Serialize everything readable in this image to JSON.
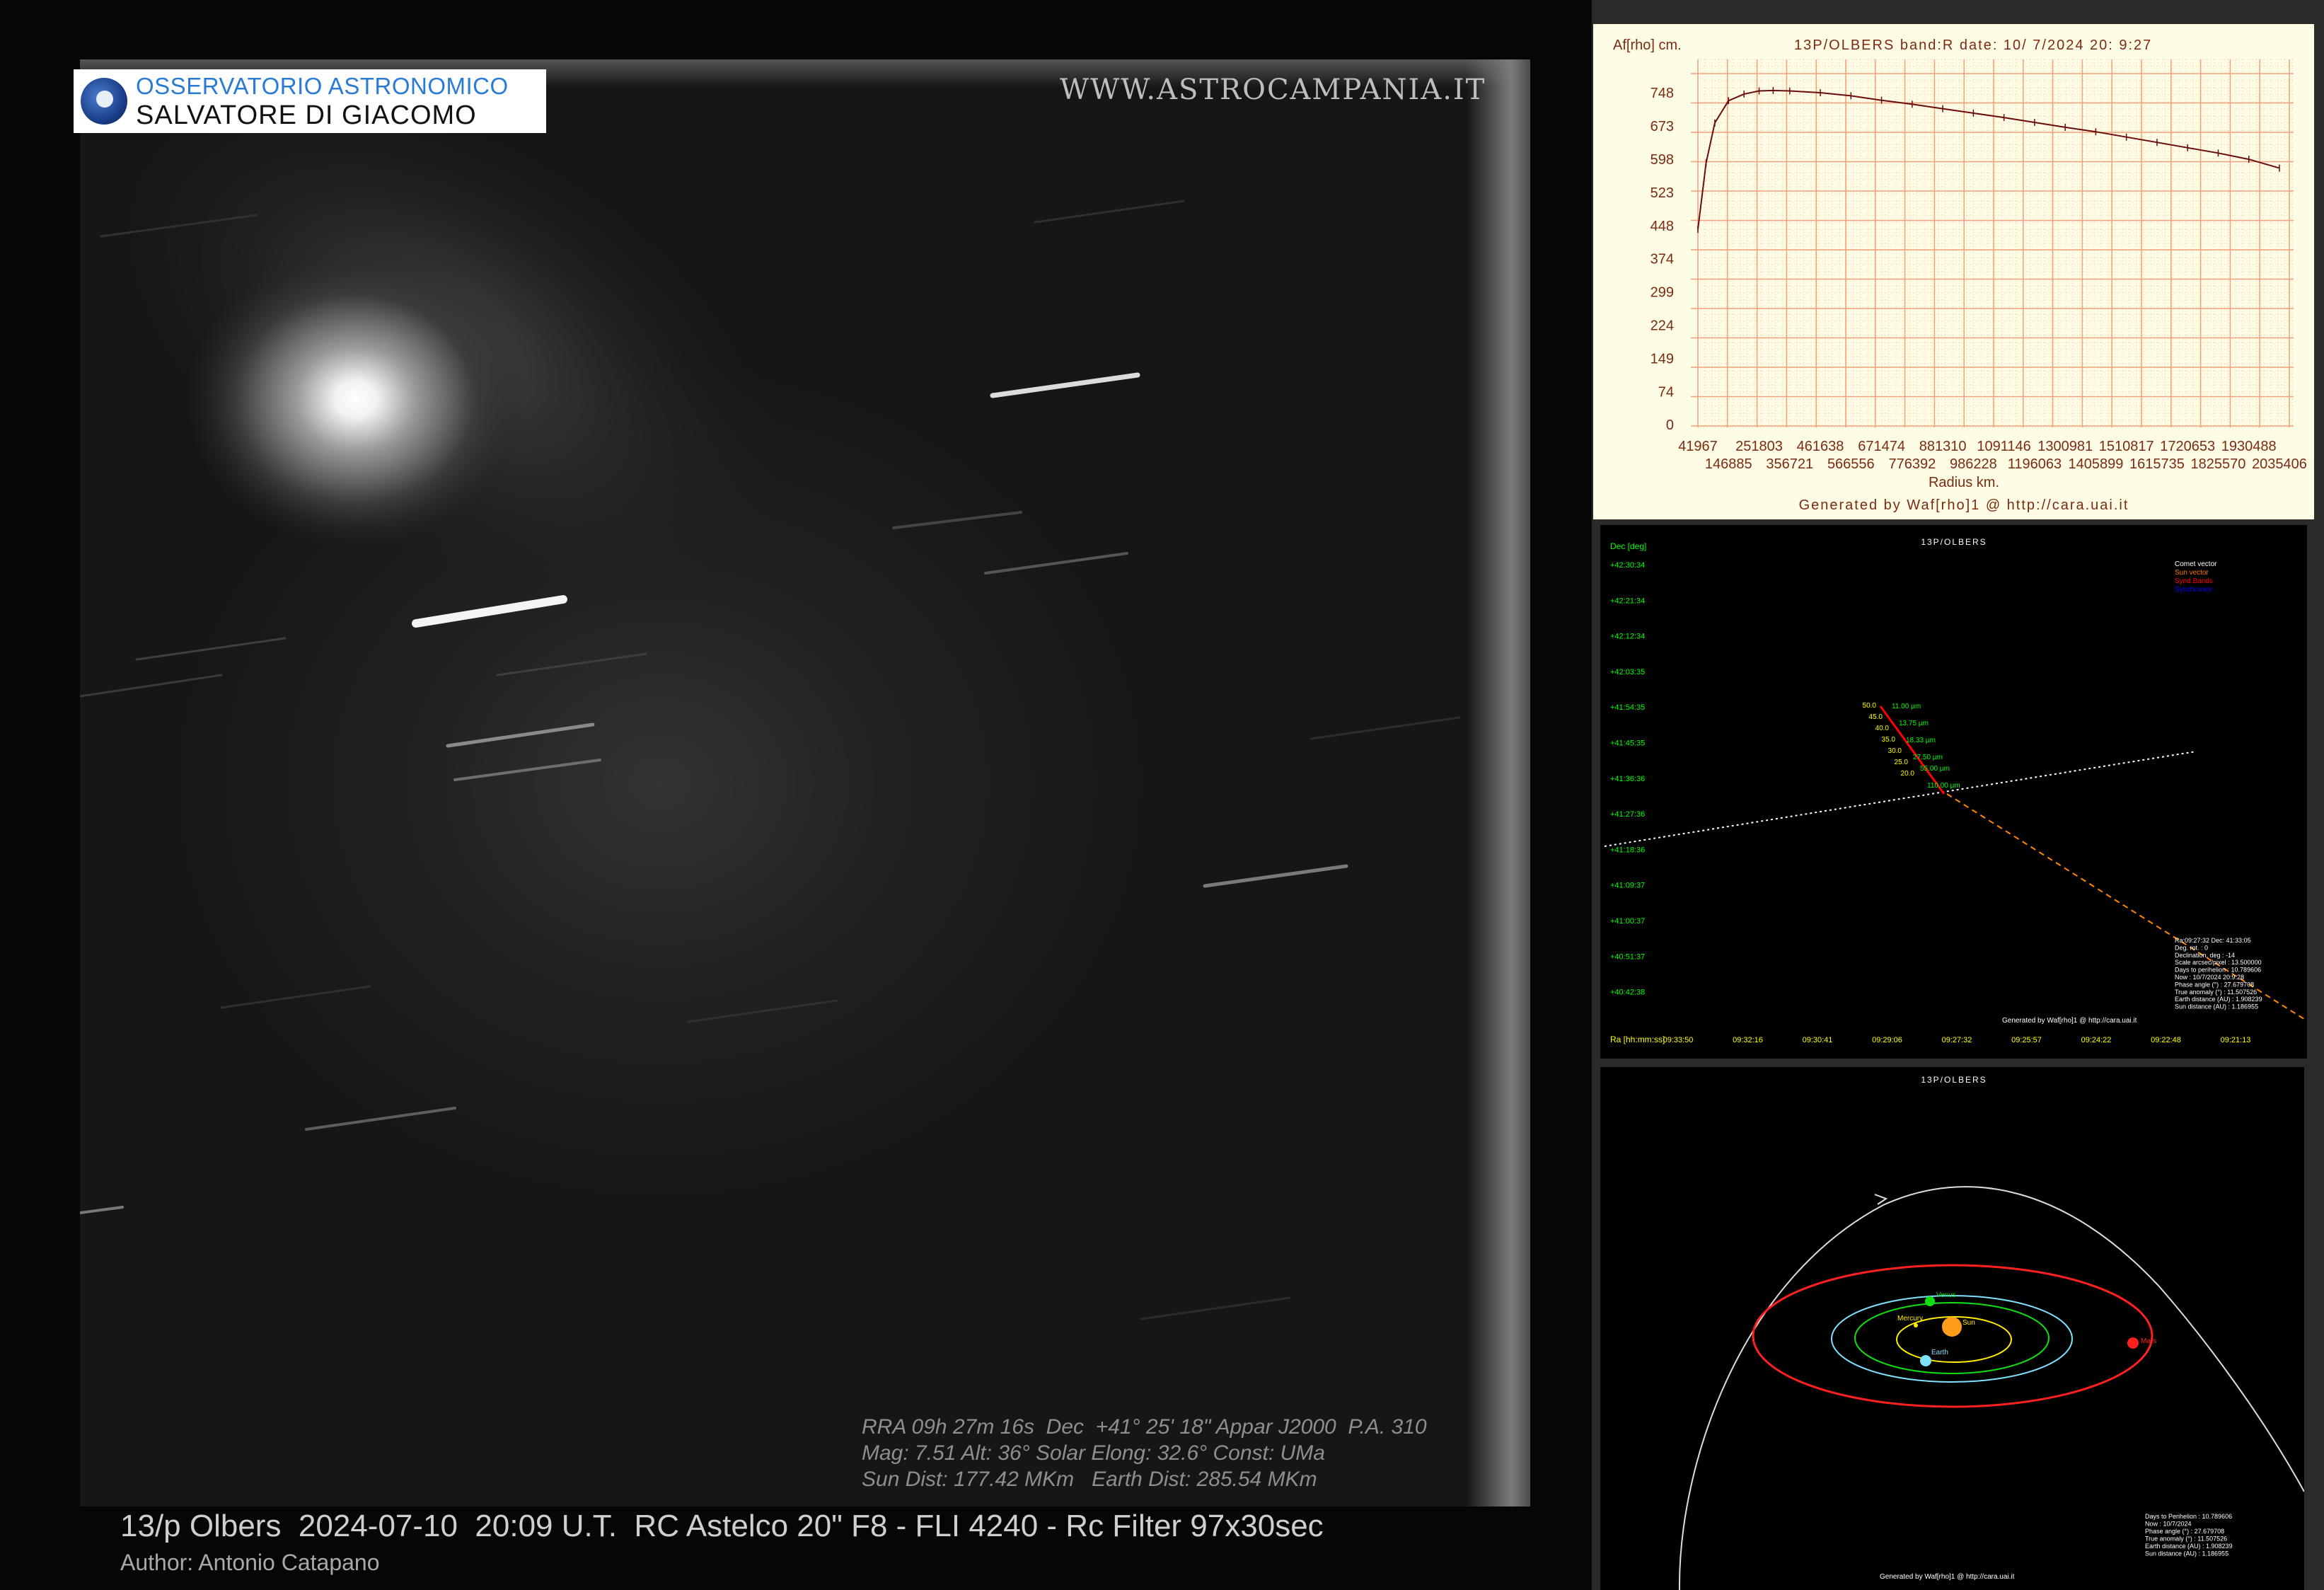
{
  "photo": {
    "logo": {
      "line1": "OSSERVATORIO ASTRONOMICO",
      "line2": "SALVATORE DI GIACOMO"
    },
    "site_url": "WWW.ASTROCAMPANIA.IT",
    "info_line1": "RRA 09h 27m 16s  Dec  +41° 25' 18\" Appar J2000  P.A. 310",
    "info_line2": "Mag: 7.51 Alt: 36° Solar Elong: 32.6° Const: UMa",
    "info_line3": "Sun Dist: 177.42 MKm   Earth Dist: 285.54 MKm",
    "caption": "13/p Olbers  2024-07-10  20:09 U.T.  RC Astelco 20\" F8 - FLI 4240 - Rc Filter 97x30sec",
    "author": "Author: Antonio Catapano"
  },
  "afrho_chart": {
    "title": "13P/OLBERS band:R date: 10/ 7/2024 20: 9:27",
    "ylabel": "Af[rho] cm.",
    "xlabel": "Radius km.",
    "footer": "Generated by Waf[rho]1 @ http://cara.uai.it",
    "y_ticks": [
      "748",
      "673",
      "598",
      "523",
      "448",
      "374",
      "299",
      "224",
      "149",
      "74",
      "0"
    ],
    "x_ticks_upper": [
      "41967",
      "251803",
      "461638",
      "671474",
      "881310",
      "1091146",
      "1300981",
      "1510817",
      "1720653",
      "1930488"
    ],
    "x_ticks_lower": [
      "146885",
      "356721",
      "566556",
      "776392",
      "986228",
      "1196063",
      "1405899",
      "1615735",
      "1825570",
      "2035406"
    ]
  },
  "chart_data": {
    "type": "line",
    "title": "13P/OLBERS band:R date: 10/ 7/2024 20: 9:27",
    "xlabel": "Radius km.",
    "ylabel": "Af[rho] cm.",
    "xlim": [
      41967,
      2035406
    ],
    "ylim": [
      0,
      823
    ],
    "grid": true,
    "x": [
      41967,
      70000,
      100000,
      146885,
      200000,
      251803,
      300000,
      356721,
      461638,
      566556,
      671474,
      776392,
      881310,
      986228,
      1091146,
      1196063,
      1300981,
      1405899,
      1510817,
      1615735,
      1720653,
      1825570,
      1930488,
      2035406
    ],
    "values": [
      440,
      590,
      680,
      730,
      745,
      752,
      753,
      752,
      748,
      741,
      731,
      722,
      712,
      702,
      692,
      681,
      670,
      660,
      648,
      636,
      624,
      612,
      598,
      578
    ]
  },
  "track_chart": {
    "title": "13P/OLBERS",
    "dec_label": "Dec [deg]",
    "ra_label": "Ra [hh:mm:ss]",
    "dec_ticks": [
      "+42:30:34",
      "+42:21:34",
      "+42:12:34",
      "+42:03:35",
      "+41:54:35",
      "+41:45:35",
      "+41:36:36",
      "+41:27:36",
      "+41:18:36",
      "+41:09:37",
      "+41:00:37",
      "+40:51:37",
      "+40:42:38"
    ],
    "ra_ticks": [
      "09:33:50",
      "09:32:16",
      "09:30:41",
      "09:29:06",
      "09:27:32",
      "09:25:57",
      "09:24:22",
      "09:22:48",
      "09:21:13"
    ],
    "legend": [
      "Comet vector",
      "Sun vector",
      "Synd.Bands",
      "Synchrones"
    ],
    "legend_colors": [
      "#ffffff",
      "#ff7700",
      "#ff0000",
      "#0000ff"
    ],
    "synd_ages": [
      "50.0",
      "45.0",
      "40.0",
      "35.0",
      "30.0",
      "25.0",
      "20.0"
    ],
    "synd_sizes": [
      "11.00 µm",
      "13.75 µm",
      "18.33 µm",
      "27.50 µm",
      "55.00 µm",
      "110.00 µm"
    ],
    "info": [
      "Ra:09:27:32 Dec: 41:33:05",
      "Deg. rot. :   0",
      "Declination, deg : -14",
      "Scale arcsec/pixel : 13.500000",
      "Days to perihelion : 10.789606",
      "Now : 10/7/2024 20:9:28",
      "Phase angle (°) : 27.679708",
      "True anomaly (°) : 11.507526",
      "Earth distance (AU) : 1.908239",
      "Sun distance (AU) : 1.186955"
    ],
    "footer": "Generated by Waf[rho]1 @ http://cara.uai.it"
  },
  "orbit_chart": {
    "title": "13P/OLBERS",
    "planets": [
      "Venus",
      "Mercury",
      "Sun",
      "Earth",
      "Mars"
    ],
    "info": [
      "Days to Perihelion : 10.789606",
      "Now : 10/7/2024",
      "Phase angle (°) : 27.679708",
      "True anomaly (°) : 11.507526",
      "Earth distance (AU) : 1.908239",
      "Sun distance (AU) : 1.186955"
    ],
    "footer": "Generated by Waf[rho]1 @ http://cara.uai.it"
  }
}
